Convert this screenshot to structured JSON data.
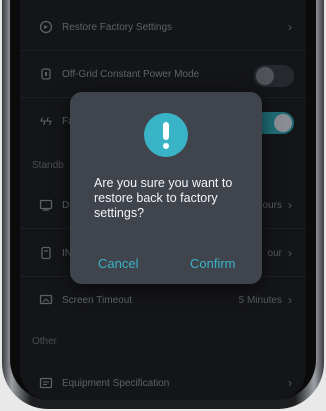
{
  "settings": {
    "rows": [
      {
        "label": "Restore Factory Settings",
        "icon": "reset-icon"
      },
      {
        "label": "Off-Grid Constant Power Mode",
        "icon": "power-plug-icon",
        "toggle": "off"
      },
      {
        "label": "Fa",
        "icon": "fast-charge-icon",
        "toggle": "on"
      },
      {
        "label": "D",
        "icon": "display-icon",
        "value": "ours"
      },
      {
        "label": "IN",
        "icon": "input-icon",
        "value": "our"
      },
      {
        "label": "Screen Timeout",
        "icon": "screen-icon",
        "value": "5 Minutes"
      },
      {
        "label": "Equipment Specification",
        "icon": "spec-icon"
      }
    ],
    "sections": {
      "standby": "Standb",
      "other": "Other"
    }
  },
  "dialog": {
    "message": "Are you sure you want to restore back to factory settings?",
    "cancel_label": "Cancel",
    "confirm_label": "Confirm",
    "icon": "exclamation-icon"
  },
  "colors": {
    "accent": "#39b3c6",
    "dialog_bg": "#40444d",
    "screen_bg": "#141519",
    "toggle_on": "#1f6c76"
  }
}
